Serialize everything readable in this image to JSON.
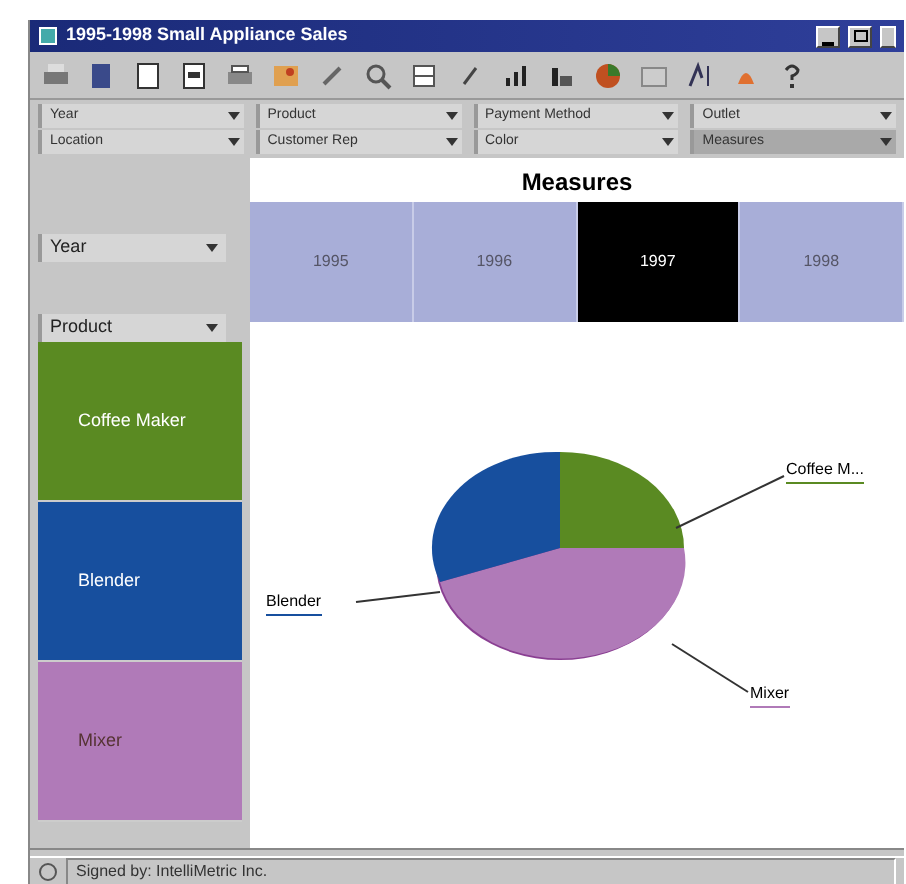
{
  "window": {
    "title": "1995-1998 Small Appliance Sales"
  },
  "filters": [
    {
      "label": "Year",
      "selected": false
    },
    {
      "label": "Product",
      "selected": false
    },
    {
      "label": "Payment Method",
      "selected": false
    },
    {
      "label": "Outlet",
      "selected": false
    },
    {
      "label": "Location",
      "selected": false
    },
    {
      "label": "Customer Rep",
      "selected": false
    },
    {
      "label": "Color",
      "selected": false
    },
    {
      "label": "Measures",
      "selected": true
    }
  ],
  "measures_title": "Measures",
  "row_dimensions": [
    {
      "label": "Year"
    },
    {
      "label": "Product"
    }
  ],
  "years": [
    {
      "label": "1995",
      "selected": false
    },
    {
      "label": "1996",
      "selected": false
    },
    {
      "label": "1997",
      "selected": true
    },
    {
      "label": "1998",
      "selected": false
    }
  ],
  "products": [
    {
      "label": "Coffee Maker",
      "color": "#5a8a22"
    },
    {
      "label": "Blender",
      "color": "#174f9e"
    },
    {
      "label": "Mixer",
      "color": "#b07ab8"
    }
  ],
  "pie_labels": [
    {
      "label": "Coffee M...",
      "color": "#5a8a22"
    },
    {
      "label": "Blender",
      "color": "#174f9e"
    },
    {
      "label": "Mixer",
      "color": "#b07ab8"
    }
  ],
  "status_bar": "Signed by: IntelliMetric Inc."
}
